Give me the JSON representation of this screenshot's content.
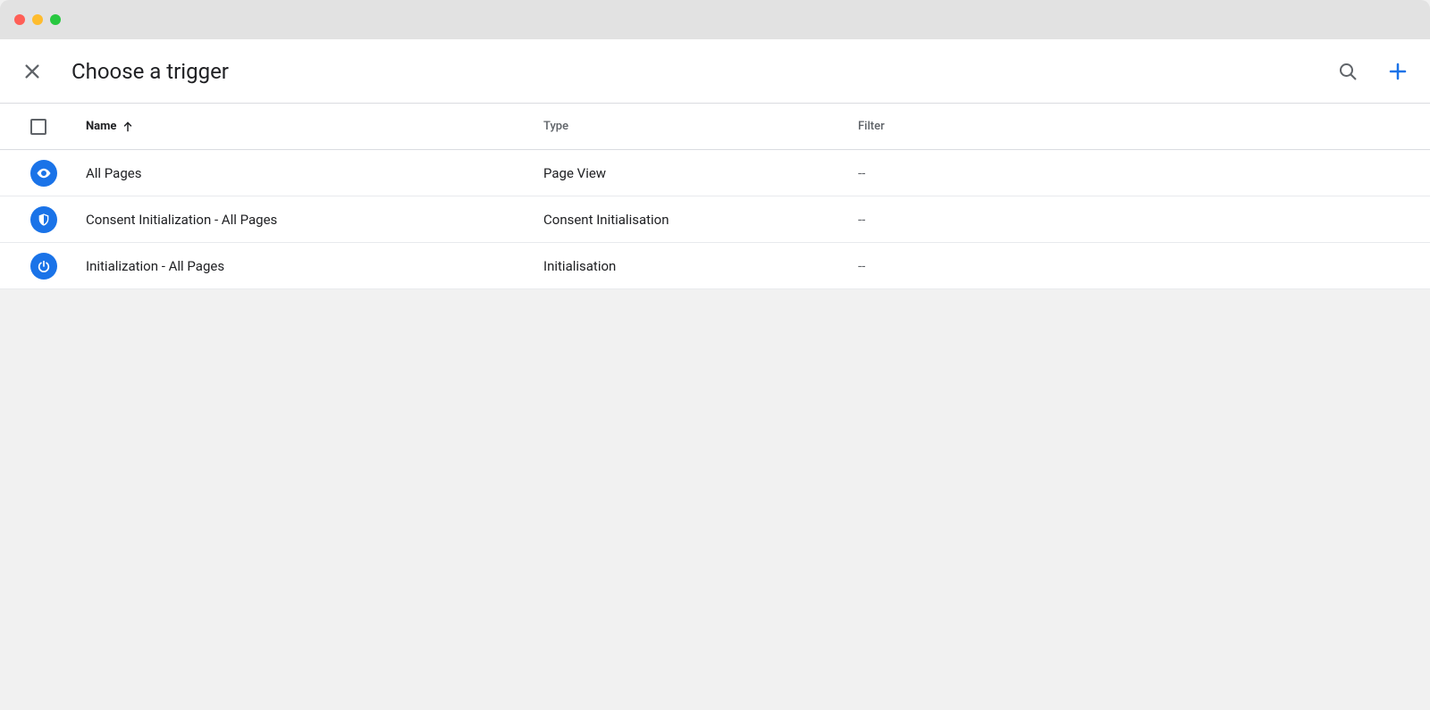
{
  "header": {
    "title": "Choose a trigger"
  },
  "columns": {
    "name": "Name",
    "type": "Type",
    "filter": "Filter"
  },
  "rows": [
    {
      "icon": "view",
      "name": "All Pages",
      "type": "Page View",
      "filter": "--"
    },
    {
      "icon": "shield",
      "name": "Consent Initialization - All Pages",
      "type": "Consent Initialisation",
      "filter": "--"
    },
    {
      "icon": "power",
      "name": "Initialization - All Pages",
      "type": "Initialisation",
      "filter": "--"
    }
  ]
}
